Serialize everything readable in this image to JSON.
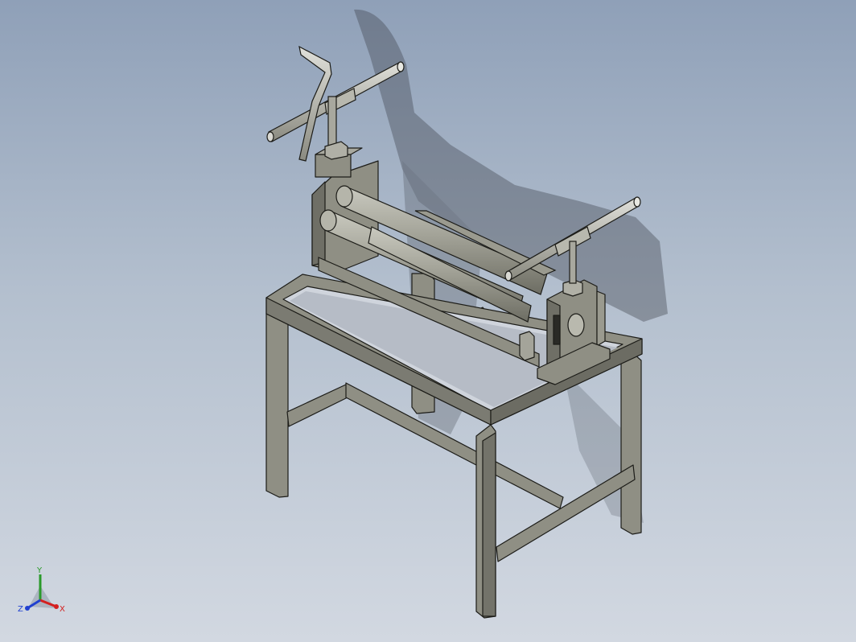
{
  "viewport": {
    "background_top": "#8fa0b8",
    "background_bottom": "#d2d8e1",
    "model_color": "#8f8f84",
    "model_edge_color": "#1c1c18",
    "shadow_color": "#3a3f48"
  },
  "triad": {
    "x_label": "X",
    "y_label": "Y",
    "z_label": "Z",
    "x_color": "#d42020",
    "y_color": "#2a9a2a",
    "z_color": "#2040d0"
  }
}
